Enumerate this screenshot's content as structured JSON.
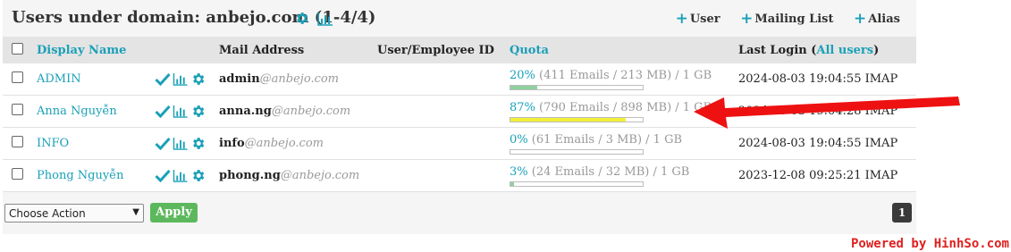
{
  "header": {
    "title": "Users under domain: anbejo.com (1-4/4)",
    "actions": [
      {
        "label": "User"
      },
      {
        "label": "Mailing List"
      },
      {
        "label": "Alias"
      }
    ]
  },
  "table": {
    "columns": {
      "display_name": "Display Name",
      "mail_address": "Mail Address",
      "employee_id": "User/Employee ID",
      "quota": "Quota",
      "last_login": "Last Login (",
      "last_login_link": "All users",
      "last_login_close": ")"
    },
    "rows": [
      {
        "name": "ADMIN",
        "user": "admin",
        "domain": "@anbejo.com",
        "pct": "20%",
        "detail": " (411 Emails / 213 MB) / 1 GB",
        "fill": 0.2,
        "fill_color": "#8fd19e",
        "login": "2024-08-03 19:04:55 IMAP"
      },
      {
        "name": "Anna Nguyễn",
        "user": "anna.ng",
        "domain": "@anbejo.com",
        "pct": "87%",
        "detail": " (790 Emails / 898 MB) / 1 GB",
        "fill": 0.87,
        "fill_color": "#f2ef3a",
        "login": "2024-08-03 19:04:28 IMAP"
      },
      {
        "name": "INFO",
        "user": "info",
        "domain": "@anbejo.com",
        "pct": "0%",
        "detail": " (61 Emails / 3 MB) / 1 GB",
        "fill": 0.0,
        "fill_color": "#8fd19e",
        "login": "2024-08-03 19:04:55 IMAP"
      },
      {
        "name": "Phong Nguyễn",
        "user": "phong.ng",
        "domain": "@anbejo.com",
        "pct": "3%",
        "detail": " (24 Emails / 32 MB) / 1 GB",
        "fill": 0.03,
        "fill_color": "#8fd19e",
        "login": "2023-12-08 09:25:21 IMAP"
      }
    ]
  },
  "footer": {
    "action_select": "Choose Action",
    "apply_label": "Apply",
    "page": "1"
  },
  "watermark": "Powered by HinhSo.com",
  "colors": {
    "accent": "#1aa0b8",
    "apply": "#5cb85c",
    "annotation_arrow": "#ee1111"
  }
}
